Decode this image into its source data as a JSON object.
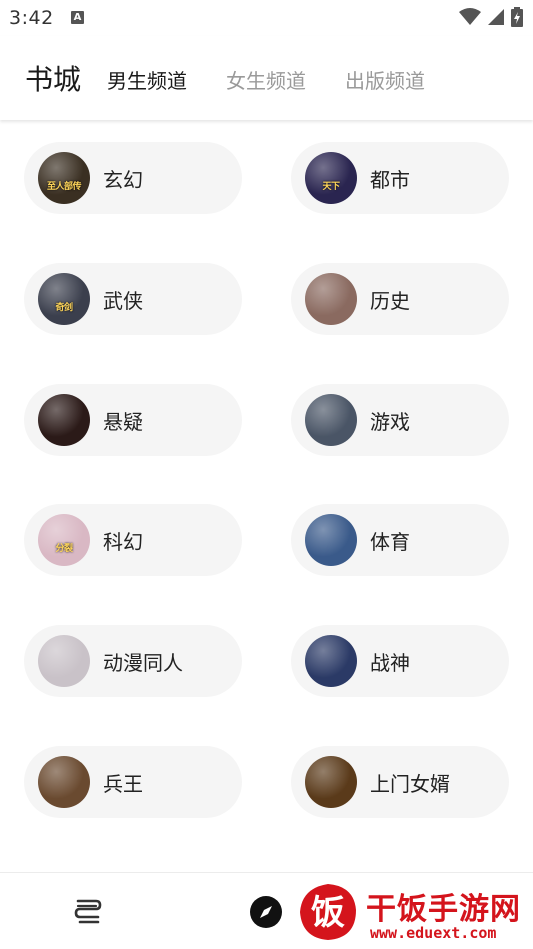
{
  "status_bar": {
    "time": "3:42",
    "notification_icon": "A"
  },
  "header": {
    "title": "书城",
    "tabs": [
      {
        "label": "男生频道",
        "active": true
      },
      {
        "label": "女生频道",
        "active": false
      },
      {
        "label": "出版频道",
        "active": false
      }
    ]
  },
  "categories": [
    {
      "label": "玄幻",
      "cover_text": "至人部传"
    },
    {
      "label": "都市",
      "cover_text": "天下"
    },
    {
      "label": "武侠",
      "cover_text": "奇剑"
    },
    {
      "label": "历史",
      "cover_text": ""
    },
    {
      "label": "悬疑",
      "cover_text": ""
    },
    {
      "label": "游戏",
      "cover_text": ""
    },
    {
      "label": "科幻",
      "cover_text": "分裂"
    },
    {
      "label": "体育",
      "cover_text": ""
    },
    {
      "label": "动漫同人",
      "cover_text": ""
    },
    {
      "label": "战神",
      "cover_text": ""
    },
    {
      "label": "兵王",
      "cover_text": ""
    },
    {
      "label": "上门女婿",
      "cover_text": ""
    }
  ],
  "cover_colors": [
    "#3a2f22",
    "#2a2550",
    "#3b3f4d",
    "#8a6a60",
    "#2b1a18",
    "#4a5566",
    "#d9b8c4",
    "#3a5a8a",
    "#c9c2c8",
    "#2b3a66",
    "#6a4a30",
    "#5a3a1a"
  ],
  "bottom_nav": {
    "items": [
      {
        "icon": "bookshelf-icon"
      },
      {
        "icon": "compass-icon"
      }
    ]
  },
  "watermark": {
    "title": "干饭手游网",
    "url": "www.eduext.com",
    "logo_char": "饭"
  }
}
